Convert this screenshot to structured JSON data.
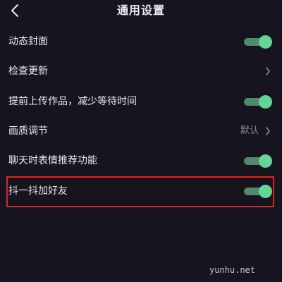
{
  "header": {
    "title": "通用设置",
    "back_icon": "chevron-left-icon"
  },
  "settings": {
    "items": [
      {
        "label": "动态封面",
        "control": "toggle",
        "on": true
      },
      {
        "label": "检查更新",
        "control": "chevron"
      },
      {
        "label": "提前上传作品，减少等待时间",
        "control": "toggle",
        "on": true
      },
      {
        "label": "画质调节",
        "control": "chevron",
        "value": "默认"
      },
      {
        "label": "聊天时表情推荐功能",
        "control": "toggle",
        "on": true
      },
      {
        "label": "抖一抖加好友",
        "control": "toggle",
        "on": true,
        "highlighted": true
      }
    ]
  },
  "colors": {
    "background": "#15141f",
    "toggle_track": "#4f8a6c",
    "toggle_knob": "#63d597",
    "highlight": "#e0231c"
  },
  "watermark": "yunhu.net"
}
